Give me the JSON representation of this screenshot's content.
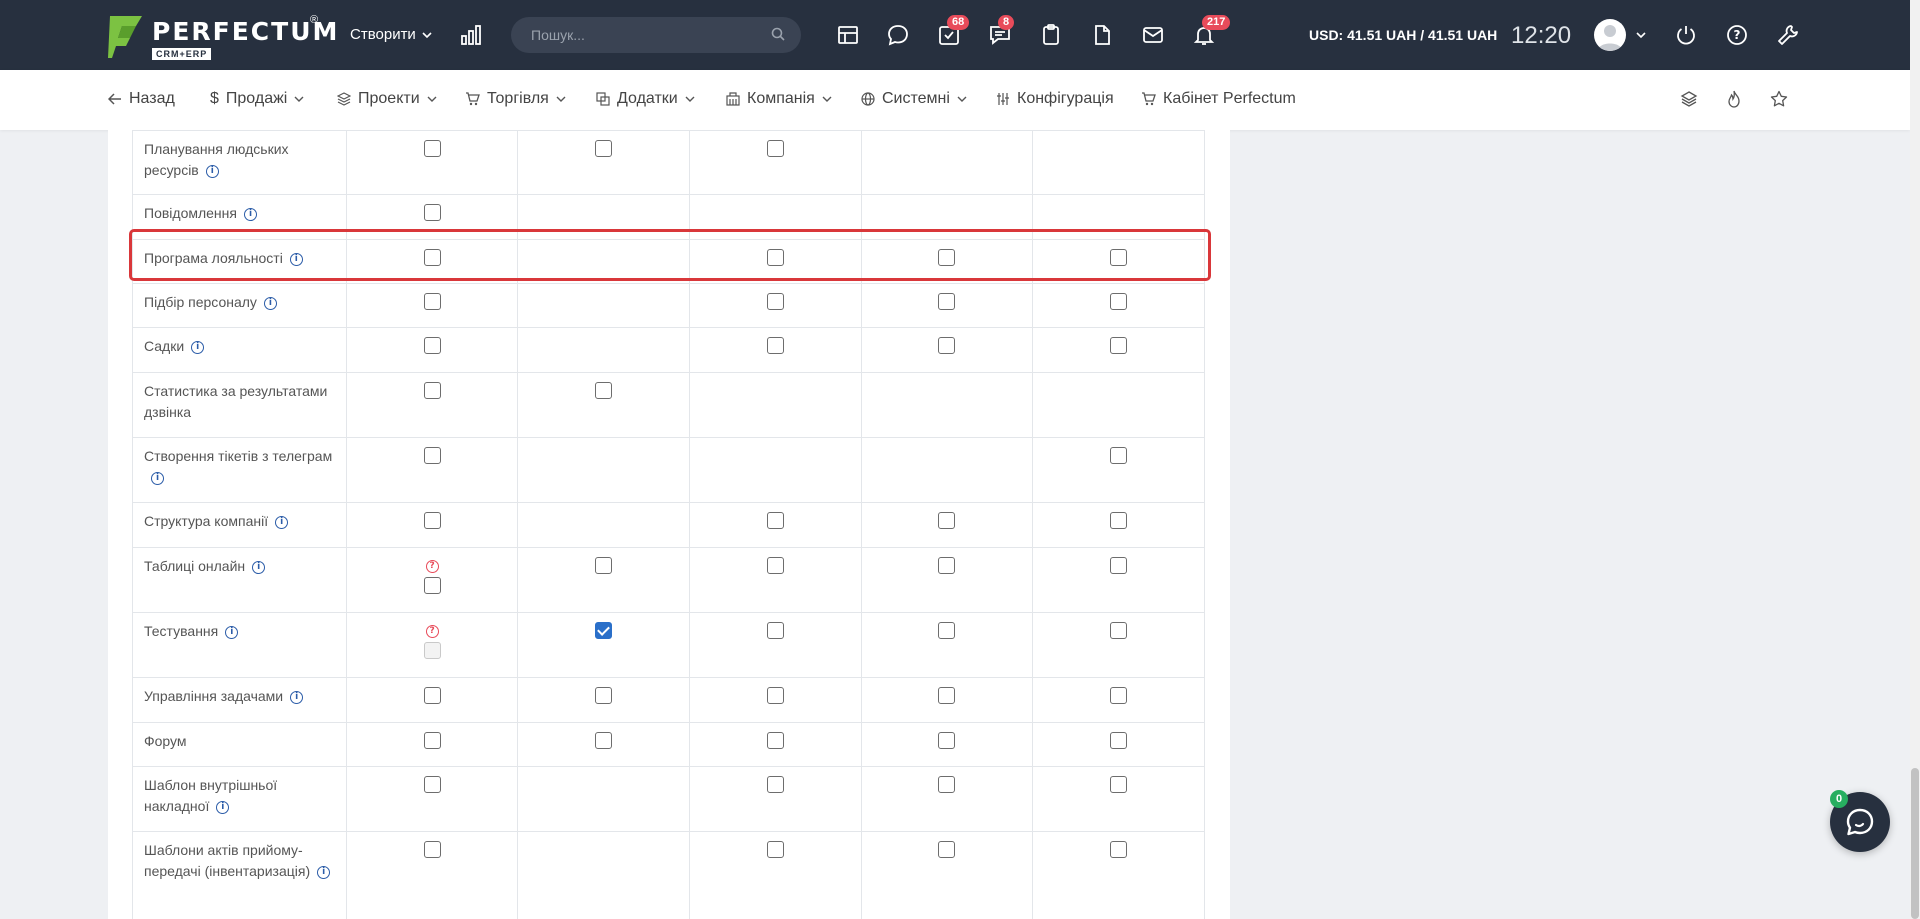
{
  "header": {
    "logo_text": "PERFECTUM",
    "logo_sup": "®",
    "logo_sub": "CRM+ERP",
    "create_label": "Створити",
    "search_placeholder": "Пошук...",
    "badges": {
      "tasks": "68",
      "chat": "8",
      "notifications": "217"
    },
    "currency": "USD: 41.51 UAH / 41.51 UAH",
    "time": "12:20"
  },
  "nav": {
    "back": "Назад",
    "sales": "Продажі",
    "projects": "Проекти",
    "trade": "Торгівля",
    "addons": "Додатки",
    "company": "Компанія",
    "system": "Системні",
    "config": "Конфігурація",
    "cabinet": "Кабінет Perfectum"
  },
  "table": {
    "rows": [
      {
        "name": "Планування людських ресурсів",
        "info": true,
        "cells": [
          "box",
          "box",
          "box",
          "",
          ""
        ]
      },
      {
        "name": "Повідомлення",
        "info": true,
        "cells": [
          "box",
          "",
          "",
          "",
          ""
        ]
      },
      {
        "name": "Програма лояльності",
        "info": true,
        "cells": [
          "box",
          "",
          "box",
          "box",
          "box"
        ]
      },
      {
        "name": "Підбір персоналу",
        "info": true,
        "cells": [
          "box",
          "",
          "box",
          "box",
          "box"
        ]
      },
      {
        "name": "Садки",
        "info": true,
        "cells": [
          "box",
          "",
          "box",
          "box",
          "box"
        ]
      },
      {
        "name": "Статистика за результатами дзвінка",
        "info": false,
        "cells": [
          "box",
          "box",
          "",
          "",
          ""
        ]
      },
      {
        "name": "Створення тікетів з телеграм",
        "info": true,
        "cells": [
          "box",
          "",
          "",
          "",
          "box"
        ]
      },
      {
        "name": "Структура компанії",
        "info": true,
        "cells": [
          "box",
          "",
          "box",
          "box",
          "box"
        ]
      },
      {
        "name": "Таблиці онлайн",
        "info": true,
        "cells": [
          "qbox",
          "box",
          "box",
          "box",
          "box"
        ]
      },
      {
        "name": "Тестування",
        "info": true,
        "cells": [
          "qdisabled",
          "checked",
          "box",
          "box",
          "box"
        ]
      },
      {
        "name": "Управління задачами",
        "info": true,
        "cells": [
          "box",
          "box",
          "box",
          "box",
          "box"
        ]
      },
      {
        "name": "Форум",
        "info": false,
        "cells": [
          "box",
          "box",
          "box",
          "box",
          "box"
        ]
      },
      {
        "name": "Шаблон внутрішньої накладної",
        "info": true,
        "cells": [
          "box",
          "",
          "box",
          "box",
          "box"
        ]
      },
      {
        "name": "Шаблони актів прийому-передачі (інвентаризація)",
        "info": true,
        "cells": [
          "box",
          "",
          "box",
          "box",
          "box"
        ]
      }
    ]
  },
  "chat": {
    "badge": "0"
  },
  "colors": {
    "topbar": "#27303f",
    "accent": "#2a6fc9",
    "badge": "#e84b5a",
    "highlight": "#d9373a"
  }
}
